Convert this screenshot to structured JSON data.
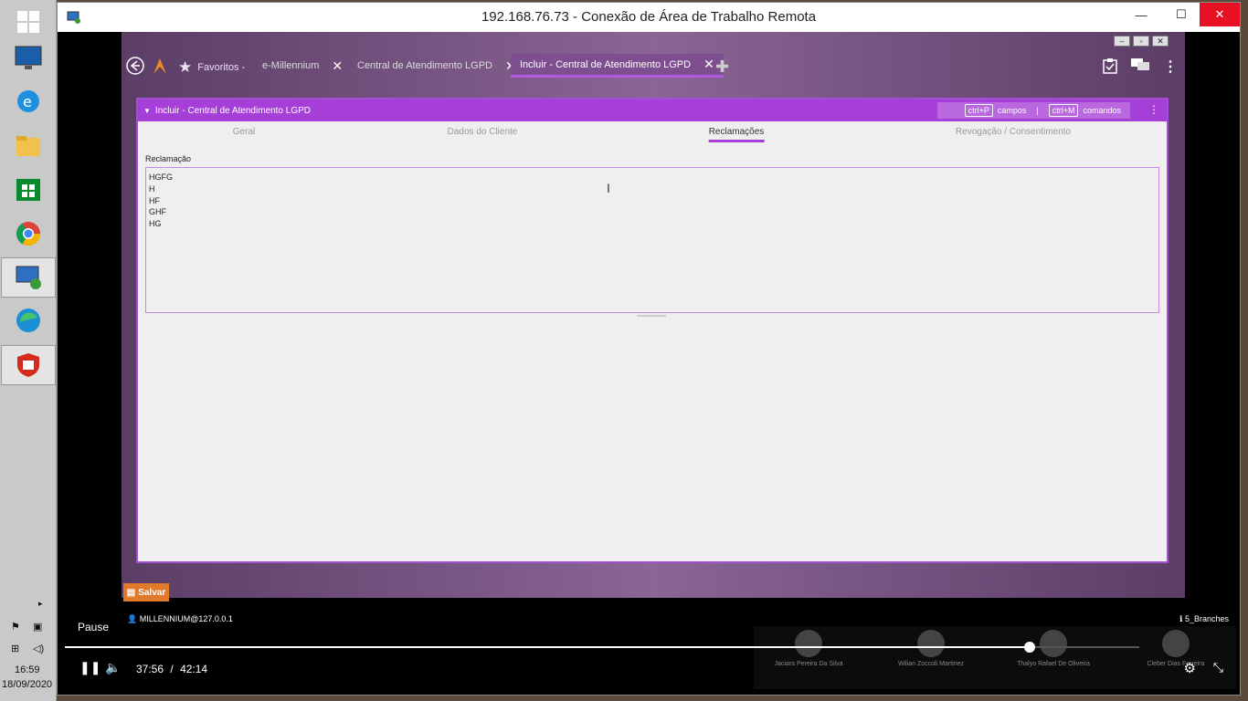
{
  "taskbar": {
    "clock_time": "16:59",
    "clock_date": "18/09/2020",
    "icons": [
      "windows-start",
      "lenovo-monitor",
      "internet-explorer",
      "file-explorer",
      "store",
      "chrome",
      "remote-desktop",
      "edge",
      "fortinet"
    ]
  },
  "rdp": {
    "title": "192.168.76.73 - Conexão de Área de Trabalho Remota",
    "minimize": "—",
    "maximize": "☐",
    "close": "✕"
  },
  "app": {
    "favorites_label": "Favoritos -",
    "tabs": [
      {
        "label": "e-Millennium",
        "close": "✕"
      },
      {
        "label": "Central de Atendimento LGPD",
        "close": "✕"
      },
      {
        "label": "Incluir - Central de Atendimento LGPD",
        "close": "✕"
      }
    ],
    "add_tab": "✚"
  },
  "form": {
    "header_title": "Incluir - Central de Atendimento LGPD",
    "shortcut_fields_key": "ctrl+P",
    "shortcut_fields_label": "campos",
    "shortcut_separator": "|",
    "shortcut_commands_key": "ctrl+M",
    "shortcut_commands_label": "comandos",
    "subtabs": [
      "Geral",
      "Dados do Cliente",
      "Reclamações",
      "Revogação / Consentimento"
    ],
    "active_subtab": "Reclamações",
    "field_label": "Reclamação",
    "field_lines": [
      "HGFG",
      "H",
      "HF",
      "GHF",
      "HG"
    ]
  },
  "footer": {
    "save_label": "Salvar",
    "user": "MILLENNIUM@127.0.0.1",
    "branches": "5_Branches"
  },
  "player": {
    "pause_label": "Pause",
    "current_time": "37:56",
    "time_separator": "/",
    "total_time": "42:14",
    "progress_fraction": 0.898,
    "participants": [
      "Jaciara Pereira Da Silva",
      "Wilian Zoccoli Martinez",
      "Thalyo Rafael De Oliveira",
      "Cleber Dias Ferreira"
    ]
  },
  "colors": {
    "accent_purple": "#a53fd8",
    "save_orange": "#e07a2a",
    "rdp_close_red": "#e81123"
  }
}
